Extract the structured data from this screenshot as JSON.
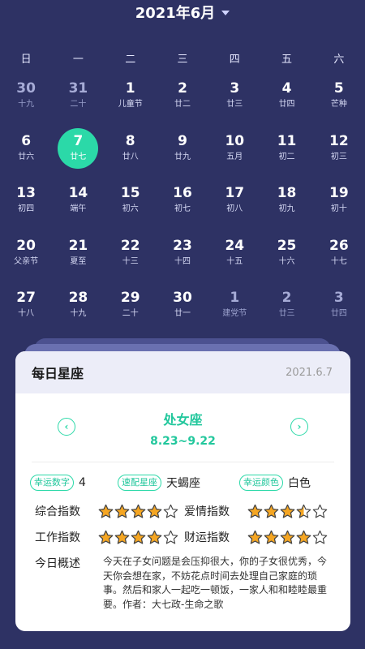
{
  "header": {
    "title": "2021年6月",
    "caret_icon": "caret-down-icon"
  },
  "weekdays": [
    "日",
    "一",
    "二",
    "三",
    "四",
    "五",
    "六"
  ],
  "days": [
    {
      "num": "30",
      "sub": "十九",
      "muted": true
    },
    {
      "num": "31",
      "sub": "二十",
      "muted": true
    },
    {
      "num": "1",
      "sub": "儿童节"
    },
    {
      "num": "2",
      "sub": "廿二"
    },
    {
      "num": "3",
      "sub": "廿三"
    },
    {
      "num": "4",
      "sub": "廿四"
    },
    {
      "num": "5",
      "sub": "芒种"
    },
    {
      "num": "6",
      "sub": "廿六"
    },
    {
      "num": "7",
      "sub": "廿七",
      "selected": true
    },
    {
      "num": "8",
      "sub": "廿八"
    },
    {
      "num": "9",
      "sub": "廿九"
    },
    {
      "num": "10",
      "sub": "五月"
    },
    {
      "num": "11",
      "sub": "初二"
    },
    {
      "num": "12",
      "sub": "初三"
    },
    {
      "num": "13",
      "sub": "初四"
    },
    {
      "num": "14",
      "sub": "端午"
    },
    {
      "num": "15",
      "sub": "初六"
    },
    {
      "num": "16",
      "sub": "初七"
    },
    {
      "num": "17",
      "sub": "初八"
    },
    {
      "num": "18",
      "sub": "初九"
    },
    {
      "num": "19",
      "sub": "初十"
    },
    {
      "num": "20",
      "sub": "父亲节"
    },
    {
      "num": "21",
      "sub": "夏至"
    },
    {
      "num": "22",
      "sub": "十三"
    },
    {
      "num": "23",
      "sub": "十四"
    },
    {
      "num": "24",
      "sub": "十五"
    },
    {
      "num": "25",
      "sub": "十六"
    },
    {
      "num": "26",
      "sub": "十七"
    },
    {
      "num": "27",
      "sub": "十八"
    },
    {
      "num": "28",
      "sub": "十九"
    },
    {
      "num": "29",
      "sub": "二十"
    },
    {
      "num": "30",
      "sub": "廿一"
    },
    {
      "num": "1",
      "sub": "建党节",
      "muted": true
    },
    {
      "num": "2",
      "sub": "廿三",
      "muted": true
    },
    {
      "num": "3",
      "sub": "廿四",
      "muted": true
    }
  ],
  "card": {
    "title": "每日星座",
    "date": "2021.6.7",
    "sign_name": "处女座",
    "sign_range": "8.23~9.22",
    "prev_icon": "chevron-left-icon",
    "next_icon": "chevron-right-icon",
    "lucky_number_label": "幸运数字",
    "lucky_number_value": "4",
    "match_sign_label": "速配星座",
    "match_sign_value": "天蝎座",
    "lucky_color_label": "幸运颜色",
    "lucky_color_value": "白色",
    "indices": [
      {
        "label": "综合指数",
        "rating": 4
      },
      {
        "label": "爱情指数",
        "rating": 3.5
      },
      {
        "label": "工作指数",
        "rating": 4
      },
      {
        "label": "财运指数",
        "rating": 4
      }
    ],
    "summary_label": "今日概述",
    "summary_text": "今天在子女问题是会压抑很大，你的子女很优秀，今天你会想在家，不妨花点时间去处理自己家庭的琐事。然后和家人一起吃一顿饭，一家人和和睦睦最重要。作者：大七政-生命之歌"
  },
  "colors": {
    "background": "#2e3264",
    "accent": "#2bd9a8",
    "star": "#f5a623"
  }
}
